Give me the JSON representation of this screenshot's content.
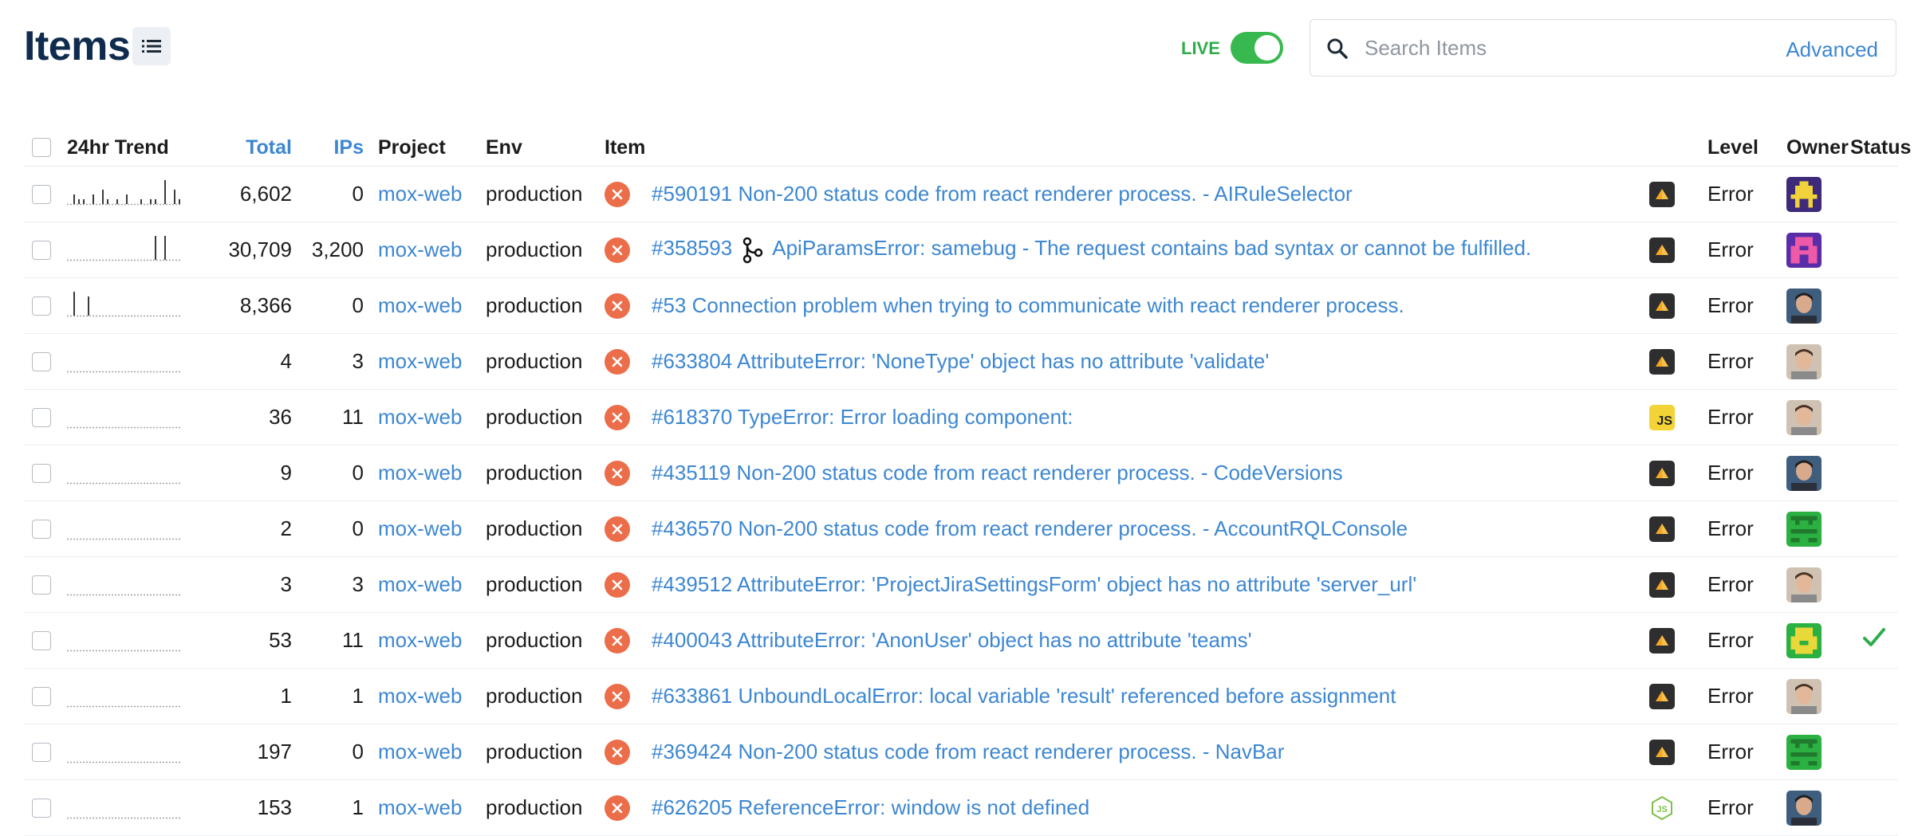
{
  "header": {
    "title": "Items",
    "live_label": "LIVE",
    "live_on": true,
    "search_placeholder": "Search Items",
    "advanced_label": "Advanced"
  },
  "columns": {
    "trend": "24hr Trend",
    "total": "Total",
    "ips": "IPs",
    "project": "Project",
    "env": "Env",
    "item": "Item",
    "level": "Level",
    "owner": "Owner",
    "status": "Status"
  },
  "rows": [
    {
      "trend": [
        0,
        2,
        1,
        1,
        0,
        2,
        0,
        3,
        1,
        0,
        1,
        0,
        2,
        0,
        0,
        1,
        0,
        1,
        1,
        0,
        5,
        0,
        3,
        1
      ],
      "total": "6,602",
      "ips": "0",
      "project": "mox-web",
      "env": "production",
      "title": "#590191 Non-200 status code from react renderer process. - AIRuleSelector",
      "branch": false,
      "framework": "python",
      "level": "Error",
      "owner": "pixel-purple-yellow",
      "status": ""
    },
    {
      "trend": [
        0,
        0,
        0,
        0,
        0,
        0,
        0,
        0,
        0,
        0,
        0,
        0,
        0,
        0,
        0,
        0,
        0,
        0,
        5,
        0,
        5,
        0,
        0,
        0
      ],
      "total": "30,709",
      "ips": "3,200",
      "project": "mox-web",
      "env": "production",
      "title": "#358593",
      "title2": "ApiParamsError: samebug - The request contains bad syntax or cannot be fulfilled.",
      "branch": true,
      "framework": "python",
      "level": "Error",
      "owner": "pixel-pink",
      "status": ""
    },
    {
      "trend": [
        0,
        5,
        0,
        0,
        4,
        0,
        0,
        0,
        0,
        0,
        0,
        0,
        0,
        0,
        0,
        0,
        0,
        0,
        0,
        0,
        0,
        0,
        0,
        0
      ],
      "total": "8,366",
      "ips": "0",
      "project": "mox-web",
      "env": "production",
      "title": "#53 Connection problem when trying to communicate with react renderer process.",
      "branch": false,
      "framework": "python",
      "level": "Error",
      "owner": "photo-dark",
      "status": ""
    },
    {
      "trend": [
        0,
        0,
        0,
        0,
        0,
        0,
        0,
        0,
        0,
        0,
        0,
        0,
        0,
        0,
        0,
        0,
        0,
        0,
        0,
        0,
        0,
        0,
        0,
        0
      ],
      "total": "4",
      "ips": "3",
      "project": "mox-web",
      "env": "production",
      "title": "#633804 AttributeError: 'NoneType' object has no attribute 'validate'",
      "branch": false,
      "framework": "python",
      "level": "Error",
      "owner": "photo-light",
      "status": ""
    },
    {
      "trend": [
        0,
        0,
        0,
        0,
        0,
        0,
        0,
        0,
        0,
        0,
        0,
        0,
        0,
        0,
        0,
        0,
        0,
        0,
        0,
        0,
        0,
        0,
        0,
        0
      ],
      "total": "36",
      "ips": "11",
      "project": "mox-web",
      "env": "production",
      "title": "#618370 TypeError: Error loading component:",
      "branch": false,
      "framework": "js",
      "fw_label": "JS",
      "level": "Error",
      "owner": "photo-light",
      "status": ""
    },
    {
      "trend": [
        0,
        0,
        0,
        0,
        0,
        0,
        0,
        0,
        0,
        0,
        0,
        0,
        0,
        0,
        0,
        0,
        0,
        0,
        0,
        0,
        0,
        0,
        0,
        0
      ],
      "total": "9",
      "ips": "0",
      "project": "mox-web",
      "env": "production",
      "title": "#435119 Non-200 status code from react renderer process. - CodeVersions",
      "branch": false,
      "framework": "python",
      "level": "Error",
      "owner": "photo-dark",
      "status": ""
    },
    {
      "trend": [
        0,
        0,
        0,
        0,
        0,
        0,
        0,
        0,
        0,
        0,
        0,
        0,
        0,
        0,
        0,
        0,
        0,
        0,
        0,
        0,
        0,
        0,
        0,
        0
      ],
      "total": "2",
      "ips": "0",
      "project": "mox-web",
      "env": "production",
      "title": "#436570 Non-200 status code from react renderer process. - AccountRQLConsole",
      "branch": false,
      "framework": "python",
      "level": "Error",
      "owner": "pixel-green",
      "status": ""
    },
    {
      "trend": [
        0,
        0,
        0,
        0,
        0,
        0,
        0,
        0,
        0,
        0,
        0,
        0,
        0,
        0,
        0,
        0,
        0,
        0,
        0,
        0,
        0,
        0,
        0,
        0
      ],
      "total": "3",
      "ips": "3",
      "project": "mox-web",
      "env": "production",
      "title": "#439512 AttributeError: 'ProjectJiraSettingsForm' object has no attribute 'server_url'",
      "branch": false,
      "framework": "python",
      "level": "Error",
      "owner": "photo-light",
      "status": ""
    },
    {
      "trend": [
        0,
        0,
        0,
        0,
        0,
        0,
        0,
        0,
        0,
        0,
        0,
        0,
        0,
        0,
        0,
        0,
        0,
        0,
        0,
        0,
        0,
        0,
        0,
        0
      ],
      "total": "53",
      "ips": "11",
      "project": "mox-web",
      "env": "production",
      "title": "#400043 AttributeError: 'AnonUser' object has no attribute 'teams'",
      "branch": false,
      "framework": "python",
      "level": "Error",
      "owner": "pixel-green-yellow",
      "status": "resolved"
    },
    {
      "trend": [
        0,
        0,
        0,
        0,
        0,
        0,
        0,
        0,
        0,
        0,
        0,
        0,
        0,
        0,
        0,
        0,
        0,
        0,
        0,
        0,
        0,
        0,
        0,
        0
      ],
      "total": "1",
      "ips": "1",
      "project": "mox-web",
      "env": "production",
      "title": "#633861 UnboundLocalError: local variable 'result' referenced before assignment",
      "branch": false,
      "framework": "python",
      "level": "Error",
      "owner": "photo-light",
      "status": ""
    },
    {
      "trend": [
        0,
        0,
        0,
        0,
        0,
        0,
        0,
        0,
        0,
        0,
        0,
        0,
        0,
        0,
        0,
        0,
        0,
        0,
        0,
        0,
        0,
        0,
        0,
        0
      ],
      "total": "197",
      "ips": "0",
      "project": "mox-web",
      "env": "production",
      "title": "#369424 Non-200 status code from react renderer process. - NavBar",
      "branch": false,
      "framework": "python",
      "level": "Error",
      "owner": "pixel-green",
      "status": ""
    },
    {
      "trend": [
        0,
        0,
        0,
        0,
        0,
        0,
        0,
        0,
        0,
        0,
        0,
        0,
        0,
        0,
        0,
        0,
        0,
        0,
        0,
        0,
        0,
        0,
        0,
        0
      ],
      "total": "153",
      "ips": "1",
      "project": "mox-web",
      "env": "production",
      "title": "#626205 ReferenceError: window is not defined",
      "branch": false,
      "framework": "node",
      "level": "Error",
      "owner": "photo-dark",
      "status": ""
    }
  ],
  "colors": {
    "link": "#3d87d2",
    "title": "#0f2c4f",
    "error": "#ec6d4a",
    "live": "#38b94f",
    "resolved": "#2eac4c"
  }
}
